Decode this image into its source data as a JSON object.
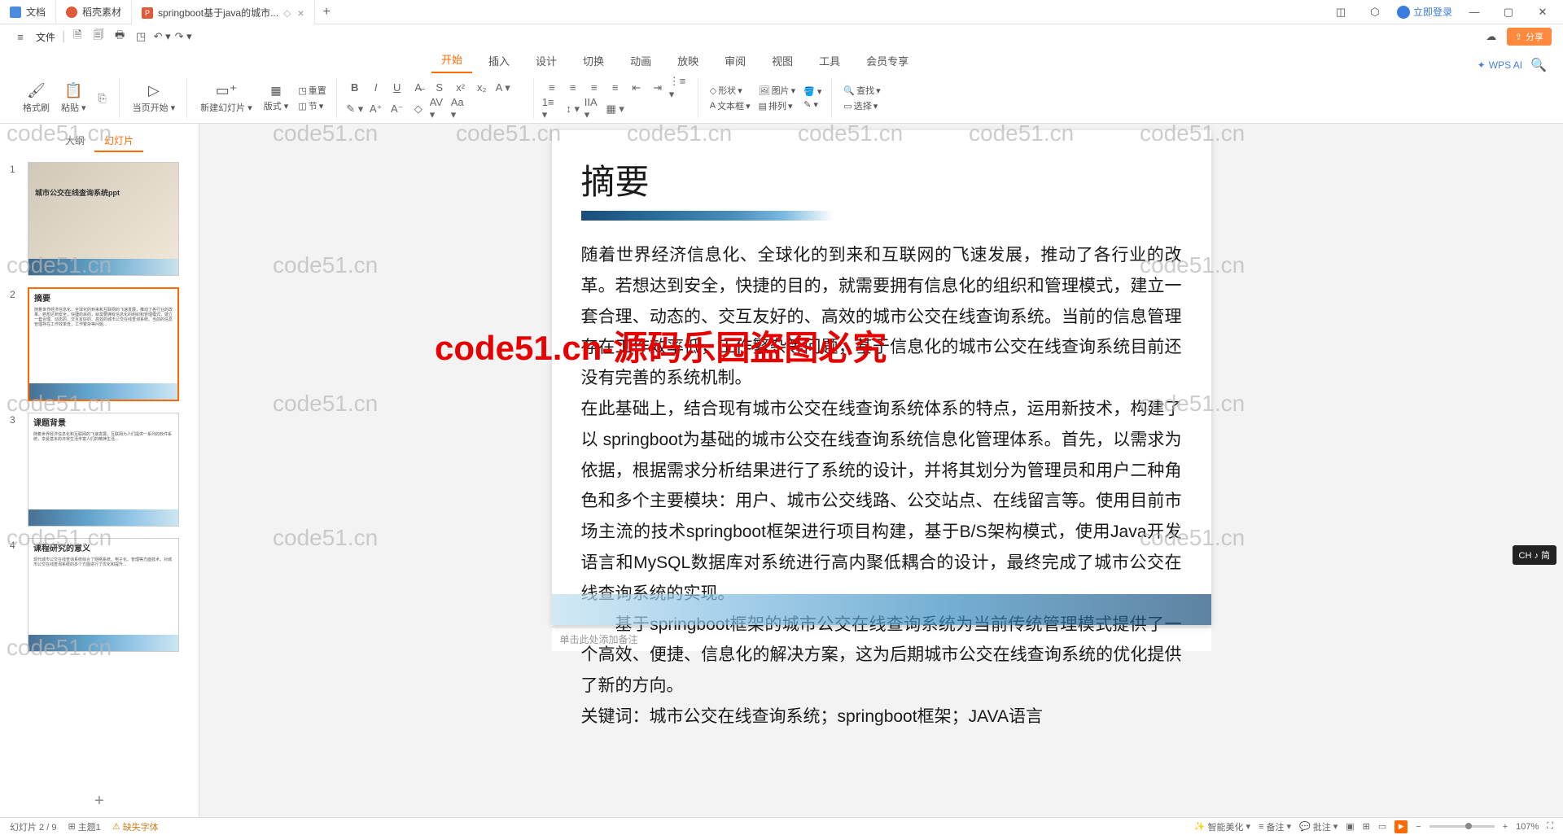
{
  "tabs": [
    {
      "icon": "doc",
      "label": "文档",
      "iconColor": "#4a8de0"
    },
    {
      "icon": "dao",
      "label": "稻壳素材",
      "iconColor": "#e05a3a"
    },
    {
      "icon": "ppt",
      "label": "springboot基于java的城市...",
      "iconColor": "#e05a3a",
      "active": true
    }
  ],
  "titlebar": {
    "login": "立即登录"
  },
  "quickbar": {
    "menu": "文件"
  },
  "share": "分享",
  "ribbonTabs": [
    "开始",
    "插入",
    "设计",
    "切换",
    "动画",
    "放映",
    "审阅",
    "视图",
    "工具",
    "会员专享"
  ],
  "ribbonActiveIndex": 0,
  "wpsAI": "WPS AI",
  "ribbon": {
    "formatPainter": "格式刷",
    "paste": "粘贴",
    "currentPageStart": "当页开始",
    "newSlide": "新建幻灯片",
    "layout": "版式",
    "reset": "重置",
    "section": "节",
    "shape": "形状",
    "picture": "图片",
    "textbox": "文本框",
    "arrange": "排列",
    "find": "查找",
    "select": "选择"
  },
  "sidebarTabs": [
    "大纲",
    "幻灯片"
  ],
  "sidebarActiveIndex": 1,
  "slides": [
    {
      "num": "1",
      "title": "城市公交在线查询系统ppt"
    },
    {
      "num": "2",
      "title": "摘要",
      "selected": true
    },
    {
      "num": "3",
      "title": "课题背景"
    },
    {
      "num": "4",
      "title": "课程研究的意义"
    }
  ],
  "currentSlide": {
    "title": "摘要",
    "body1": "随着世界经济信息化、全球化的到来和互联网的飞速发展，推动了各行业的改革。若想达到安全，快捷的目的，就需要拥有信息化的组织和管理模式，建立一套合理、动态的、交互友好的、高效的城市公交在线查询系统。当前的信息管理存在工作效率低，工作繁杂等问题，基于信息化的城市公交在线查询系统目前还没有完善的系统机制。",
    "body2": "在此基础上，结合现有城市公交在线查询系统体系的特点，运用新技术，构建了以 springboot为基础的城市公交在线查询系统信息化管理体系。首先，以需求为依据，根据需求分析结果进行了系统的设计，并将其划分为管理员和用户二种角色和多个主要模块：用户、城市公交线路、公交站点、在线留言等。使用目前市场主流的技术springboot框架进行项目构建，基于B/S架构模式，使用Java开发语言和MySQL数据库对系统进行高内聚低耦合的设计，最终完成了城市公交在线查询系统的实现。",
    "body3": "基于springboot框架的城市公交在线查询系统为当前传统管理模式提供了一个高效、便捷、信息化的解决方案，这为后期城市公交在线查询系统的优化提供了新的方向。",
    "body4": "关键词：城市公交在线查询系统；springboot框架；JAVA语言"
  },
  "notesPlaceholder": "单击此处添加备注",
  "statusbar": {
    "slideCount": "幻灯片 2 / 9",
    "theme": "主题1",
    "missingFont": "缺失字体",
    "smartBeautify": "智能美化",
    "notes": "备注",
    "approve": "批注",
    "zoom": "107%"
  },
  "ime": "CH ♪ 简",
  "watermark": "code51.cn",
  "watermarkRed": "code51.cn-源码乐园盗图必究"
}
